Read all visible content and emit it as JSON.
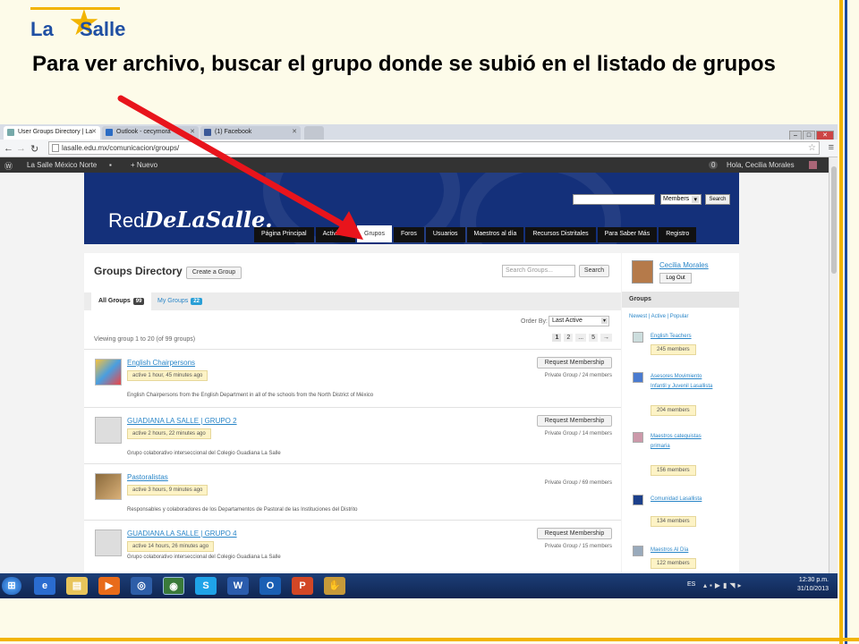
{
  "slide": {
    "brand": "LaSalle",
    "headline": "Para ver archivo, buscar el grupo donde se subió en el listado de grupos"
  },
  "browser": {
    "tabs": [
      {
        "label": "User Groups Directory | La",
        "active": true
      },
      {
        "label": "Outlook - cecymora",
        "active": false
      },
      {
        "label": "(1) Facebook",
        "active": false
      }
    ],
    "url": "lasalle.edu.mx/comunicacion/groups/",
    "adminbar": {
      "site": "La Salle México Norte",
      "new": "+ Nuevo",
      "count": "0",
      "greeting": "Hola, Cecilia Morales"
    }
  },
  "site": {
    "brand_prefix": "Red",
    "brand_script": "DeLaSalle.",
    "header_select": "Members",
    "header_search_btn": "Search",
    "menu": [
      "Página Principal",
      "Actividad",
      "Grupos",
      "Foros",
      "Usuarios",
      "Maestros al día",
      "Recursos Distritales",
      "Para Saber Más",
      "Registro"
    ],
    "active_menu": "Grupos"
  },
  "directory": {
    "title": "Groups Directory",
    "create_btn": "Create a Group",
    "search_placeholder": "Search Groups...",
    "search_btn": "Search",
    "tabs": [
      {
        "label": "All Groups",
        "count": "99"
      },
      {
        "label": "My Groups",
        "count": "22"
      }
    ],
    "order_label": "Order By:",
    "order_value": "Last Active",
    "viewing": "Viewing group 1 to 20 (of 99 groups)",
    "pages": [
      "1",
      "2",
      "...",
      "5",
      "→"
    ],
    "groups": [
      {
        "name": "English Chairpersons",
        "active": "active 1 hour, 45 minutes ago",
        "desc": "English Chairpersons from the English Department in all of the schools from the North District of México",
        "btn": "Request Membership",
        "meta": "Private Group / 24 members"
      },
      {
        "name": "GUADIANA LA SALLE | GRUPO 2",
        "active": "active 2 hours, 22 minutes ago",
        "desc": "Grupo colaborativo interseccional del Colegio Guadiana La Salle",
        "btn": "Request Membership",
        "meta": "Private Group / 14 members"
      },
      {
        "name": "Pastoralistas",
        "active": "active 3 hours, 9 minutes ago",
        "desc": "Responsables y colaboradores de los Departamentos de Pastoral de las Instituciones del Distrito",
        "btn": "",
        "meta": "Private Group / 69 members"
      },
      {
        "name": "GUADIANA LA SALLE | GRUPO 4",
        "active": "active 14 hours, 26 minutes ago",
        "desc": "Grupo colaborativo interseccional del Colegio Guadiana La Salle",
        "btn": "Request Membership",
        "meta": "Private Group / 15 members"
      }
    ]
  },
  "sidebar": {
    "user": "Cecilia Morales",
    "logout": "Log Out",
    "groups_title": "Groups",
    "filters": "Newest | Active | Popular",
    "groups": [
      {
        "name": "English Teachers",
        "members": "245 members"
      },
      {
        "name": "Asesores Movimiento Infantil y Juvenil Lasallista",
        "members": "204 members"
      },
      {
        "name": "Maestros catequistas primaria",
        "members": "156 members"
      },
      {
        "name": "Comunidad Lasallista",
        "members": "134 members"
      },
      {
        "name": "Maestros Al Día",
        "members": "122 members"
      }
    ]
  },
  "taskbar": {
    "lang": "ES",
    "time": "12:30 p.m.",
    "date": "31/10/2013"
  },
  "colors": {
    "accent": "#f2b400",
    "navy": "#14307a",
    "link": "#2a86c8",
    "arrow": "#e8141c"
  }
}
